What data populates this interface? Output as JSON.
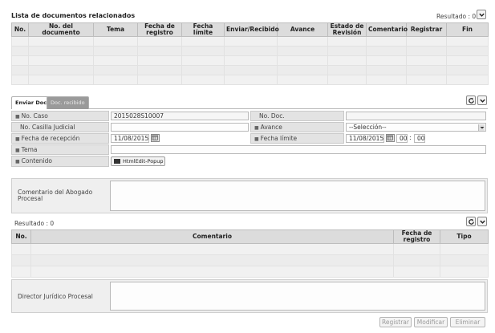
{
  "top_list": {
    "title": "Lista de documentos relacionados",
    "result": "Resultado : 0",
    "columns": [
      "No.",
      "No. del documento",
      "Tema",
      "Fecha de registro",
      "Fecha límite",
      "Enviar/Recibido",
      "Avance",
      "Estado de Revisión",
      "Comentario",
      "Registrar",
      "Fin"
    ]
  },
  "tabs": {
    "active": "Enviar Doc.",
    "inactive": "Doc. recibido"
  },
  "form": {
    "no_caso_label": "No. Caso",
    "no_caso_value": "2015028S10007",
    "no_doc_label": "No. Doc.",
    "casilla_label": "No. Casilla Judicial",
    "avance_label": "Avance",
    "avance_value": "--Selección--",
    "fecha_recepcion_label": "Fecha de recepción",
    "fecha_recepcion_value": "11/08/2015",
    "fecha_limite_label": "Fecha límite",
    "fecha_limite_value": "11/08/2015",
    "hour_value": "00",
    "time_sep": ":",
    "minute_value": "00",
    "tema_label": "Tema",
    "contenido_label": "Contenido",
    "htmledit_label": "HtmlEdit-Popup"
  },
  "comentario_abogado_label": "Comentario del Abogado Procesal",
  "comments_list": {
    "result": "Resultado : 0",
    "columns": [
      "No.",
      "Comentario",
      "Fecha de registro",
      "Tipo"
    ]
  },
  "director_label": "Director Jurídico Procesal",
  "buttons": {
    "registrar": "Registrar",
    "modificar": "Modificar",
    "eliminar": "Eliminar"
  }
}
